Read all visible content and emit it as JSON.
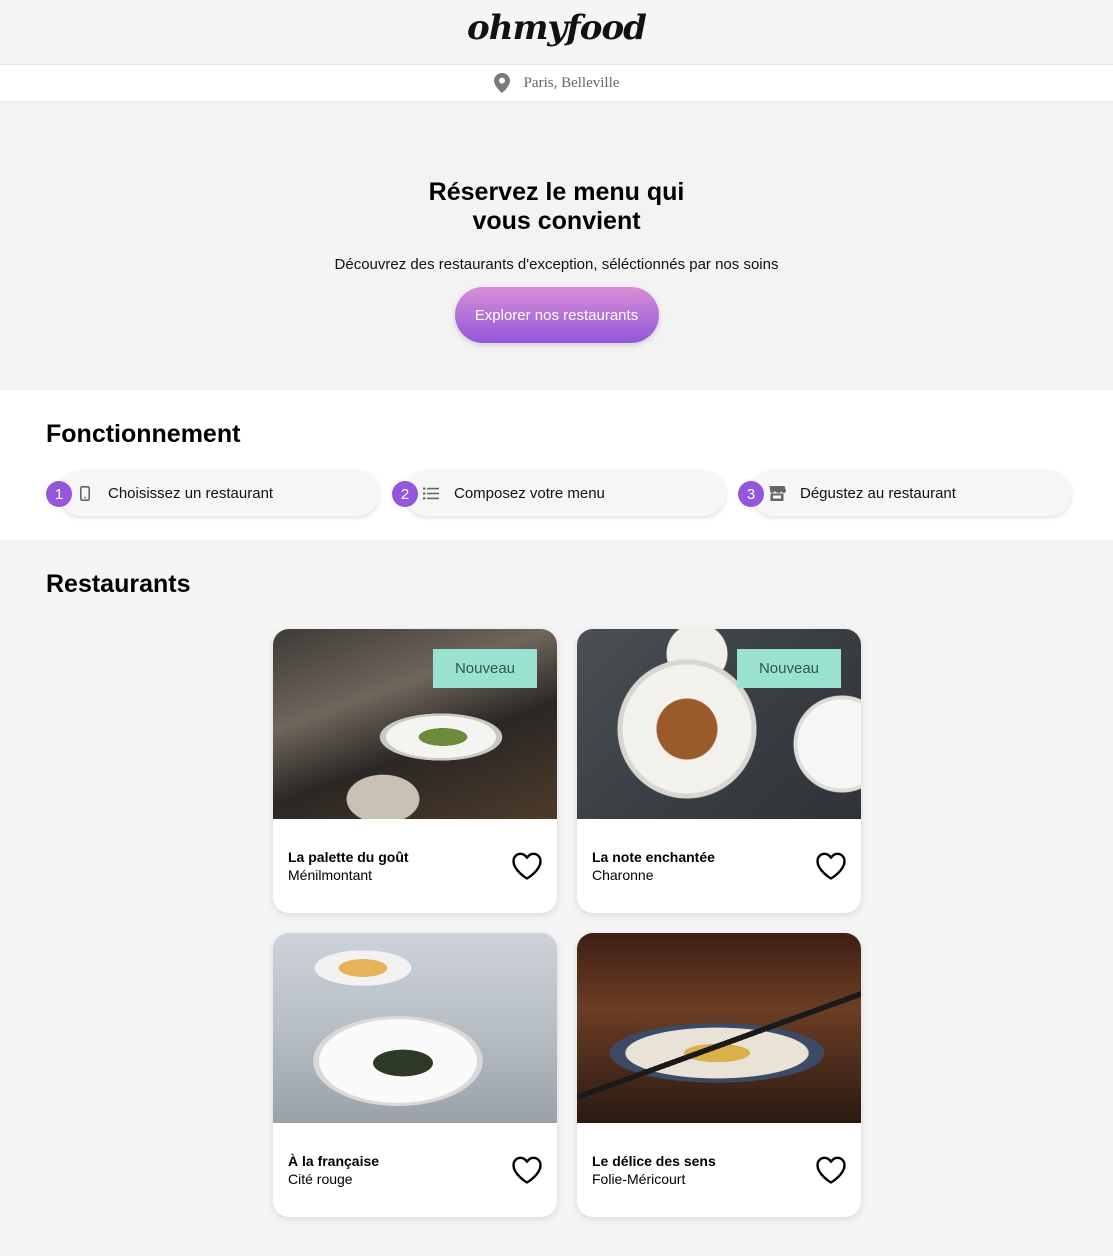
{
  "header": {
    "logo": "ohmyfood"
  },
  "location": {
    "text": "Paris, Belleville",
    "icon": "map-pin-icon"
  },
  "hero": {
    "title": "Réservez le menu qui vous convient",
    "subtitle": "Découvrez des restaurants d'exception, séléctionnés par nos soins",
    "cta_label": "Explorer nos restaurants"
  },
  "how": {
    "title": "Fonctionnement",
    "steps": [
      {
        "number": "1",
        "icon": "mobile-phone-icon",
        "label": "Choisissez un restaurant"
      },
      {
        "number": "2",
        "icon": "list-icon",
        "label": "Composez votre menu"
      },
      {
        "number": "3",
        "icon": "store-icon",
        "label": "Dégustez au restaurant"
      }
    ]
  },
  "restaurants": {
    "title": "Restaurants",
    "items": [
      {
        "name": "La palette du goût",
        "area": "Ménilmontant",
        "badge": "Nouveau"
      },
      {
        "name": "La note enchantée",
        "area": "Charonne",
        "badge": "Nouveau"
      },
      {
        "name": "À la française",
        "area": "Cité rouge",
        "badge": ""
      },
      {
        "name": "Le délice des sens",
        "area": "Folie-Méricourt",
        "badge": ""
      }
    ]
  },
  "colors": {
    "accent": "#9356dc",
    "badge_bg": "#99e2d0",
    "cta_gradient_start": "#d88fd6",
    "cta_gradient_end": "#9356dc"
  }
}
